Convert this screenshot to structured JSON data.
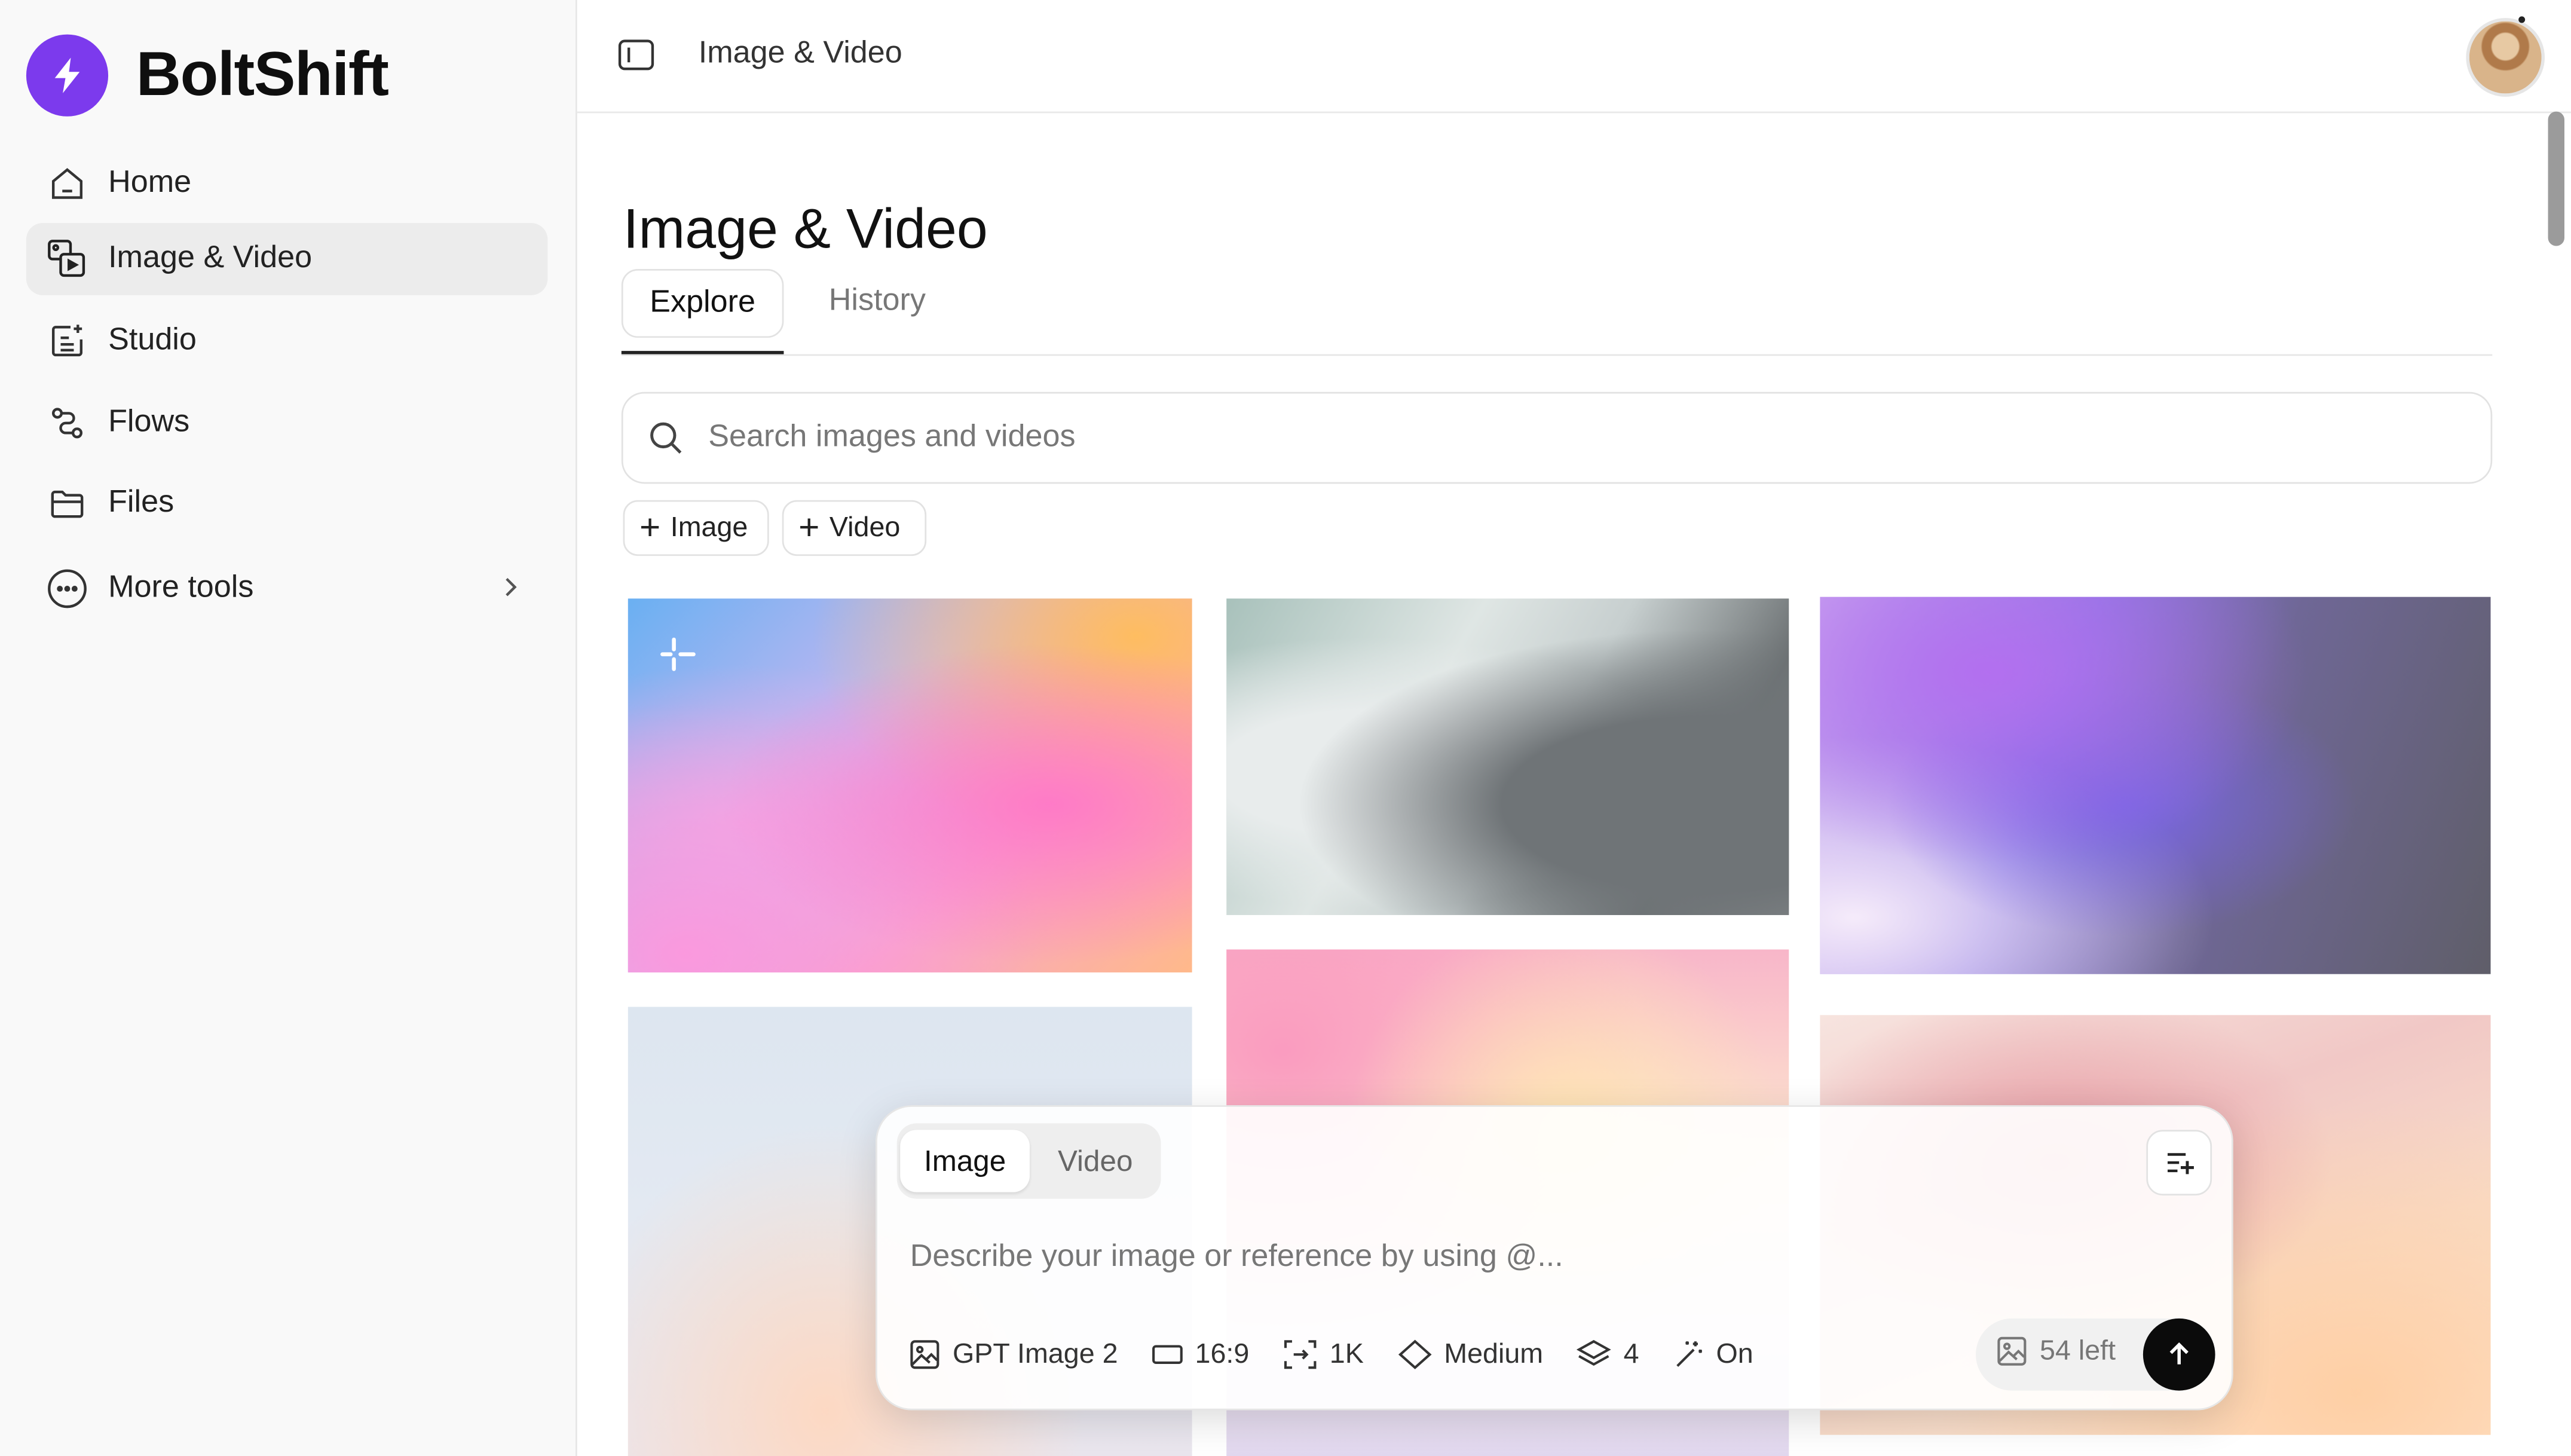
{
  "app": {
    "name": "BoltShift",
    "brand_color": "#7c3aed"
  },
  "sidebar": {
    "items": [
      {
        "label": "Home",
        "icon": "home-icon"
      },
      {
        "label": "Image & Video",
        "icon": "image-video-icon",
        "active": true
      },
      {
        "label": "Studio",
        "icon": "studio-icon"
      },
      {
        "label": "Flows",
        "icon": "flows-icon"
      },
      {
        "label": "Files",
        "icon": "files-icon"
      },
      {
        "label": "More tools",
        "icon": "more-icon"
      }
    ]
  },
  "header": {
    "breadcrumb": "Image & Video"
  },
  "main": {
    "title": "Image & Video",
    "tabs": [
      {
        "label": "Explore",
        "active": true
      },
      {
        "label": "History"
      }
    ],
    "search": {
      "placeholder": "Search images and videos"
    },
    "filters": [
      {
        "label": "Image"
      },
      {
        "label": "Video"
      }
    ]
  },
  "composer": {
    "modes": [
      {
        "label": "Image",
        "active": true
      },
      {
        "label": "Video"
      }
    ],
    "placeholder": "Describe your image or reference by using @...",
    "options": {
      "model": "GPT Image 2",
      "aspect": "16:9",
      "resolution": "1K",
      "quality": "Medium",
      "count": "4",
      "enhance": "On"
    },
    "credits": "54 left"
  }
}
